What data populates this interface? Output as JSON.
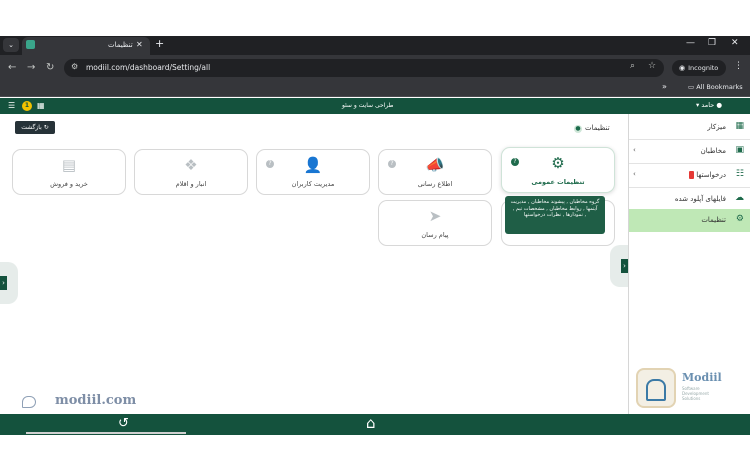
{
  "browser": {
    "tab_title": "تنظیمات",
    "url": "modiil.com/dashboard/Setting/all",
    "incognito_label": "Incognito",
    "bookmarks_label": "All Bookmarks"
  },
  "header": {
    "center_title": "طراحی سایت و سئو",
    "user_name": "حامد",
    "notification_count": "1"
  },
  "toolbar": {
    "back_label": "بازگشت",
    "breadcrumb": "تنظیمات"
  },
  "cards": [
    {
      "label": "تنظیمات عمومی",
      "icon": "gears-icon"
    },
    {
      "label": "اطلاع رسانی",
      "icon": "megaphone-icon"
    },
    {
      "label": "مدیریت کاربران",
      "icon": "user-gear-icon"
    },
    {
      "label": "انبار و اقلام",
      "icon": "boxes-icon"
    },
    {
      "label": "خرید و فروش",
      "icon": "cash-register-icon"
    },
    {
      "label": "پیام رسان",
      "icon": "paper-plane-icon"
    }
  ],
  "tooltip_text": "گروه مخاطبان , پیشوند مخاطبان , مدیریت آیتمها , روابط مخاطبان , مشخصات تیم , نمودارها , نظرات درخواستها ,",
  "sidebar": {
    "items": [
      {
        "label": "میزکار",
        "icon": "grid-icon"
      },
      {
        "label": "مخاطبان",
        "icon": "contacts-icon"
      },
      {
        "label": "درخواستها",
        "icon": "list-icon"
      },
      {
        "label": "فایلهای آپلود شده",
        "icon": "cloud-upload-icon"
      },
      {
        "label": "تنظیمات",
        "icon": "gear-icon"
      }
    ]
  },
  "logo_text": "Modiil",
  "logo_subtitle": "Software Development Solutions",
  "watermark": "modiil.com",
  "colors": {
    "brand": "#14523d",
    "accent": "#1f6b4c",
    "active_sidebar": "#bfe8b6",
    "badge": "#e53935"
  }
}
